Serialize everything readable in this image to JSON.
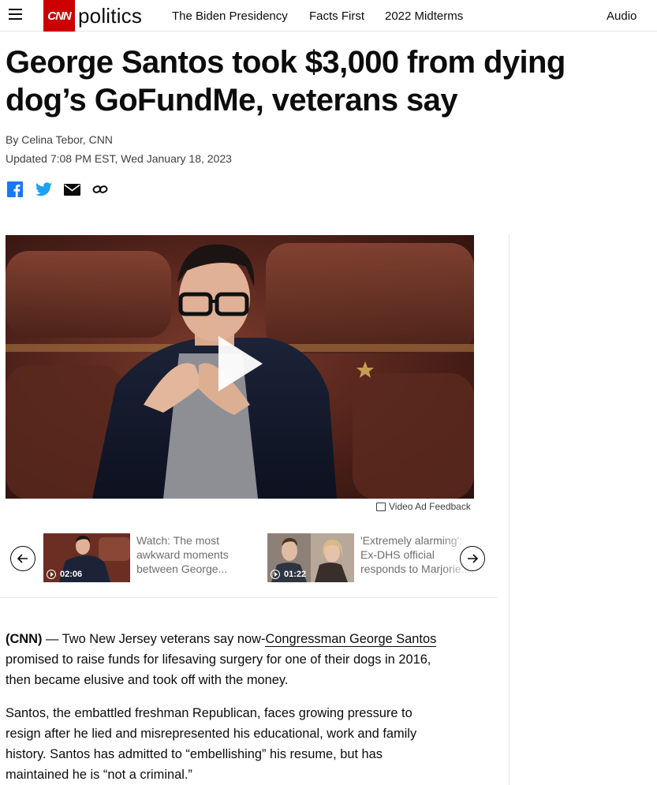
{
  "header": {
    "section": "politics",
    "brand": "CNN",
    "nav": [
      "The Biden Presidency",
      "Facts First",
      "2022 Midterms"
    ],
    "audio": "Audio"
  },
  "article": {
    "headline": "George Santos took $3,000 from dying dog’s GoFundMe, veterans say",
    "byline_prefix": "By ",
    "author": "Celina Tebor, CNN",
    "updated": "Updated 7:08 PM EST, Wed January 18, 2023",
    "share_icons": [
      "facebook-icon",
      "twitter-icon",
      "email-icon",
      "link-icon"
    ],
    "paragraphs": [
      {
        "source": "(CNN)",
        "dash": " — ",
        "before": "Two New Jersey veterans say now-",
        "link": "Congressman George Santos",
        "after": " promised to raise funds for lifesaving surgery for one of their dogs in 2016, then became elusive and took off with the money."
      },
      {
        "text": "Santos, the embattled freshman Republican, faces growing pressure to resign after he lied and misrepresented his educational, work and family history. Santos has admitted to “embellishing” his resume, but has maintained he is “not a criminal.”"
      }
    ]
  },
  "video": {
    "feedback": "Video Ad Feedback"
  },
  "carousel": {
    "items": [
      {
        "duration": "02:06",
        "title": "Watch: The most awkward moments between George..."
      },
      {
        "duration": "01:22",
        "title": "'Extremely alarming': Ex-DHS official responds to Marjorie..."
      }
    ]
  },
  "colors": {
    "brand_red": "#cc0000",
    "text": "#0c0c0c",
    "muted": "#6e6e6e",
    "twitter": "#1da1f2",
    "facebook": "#1877f2"
  }
}
